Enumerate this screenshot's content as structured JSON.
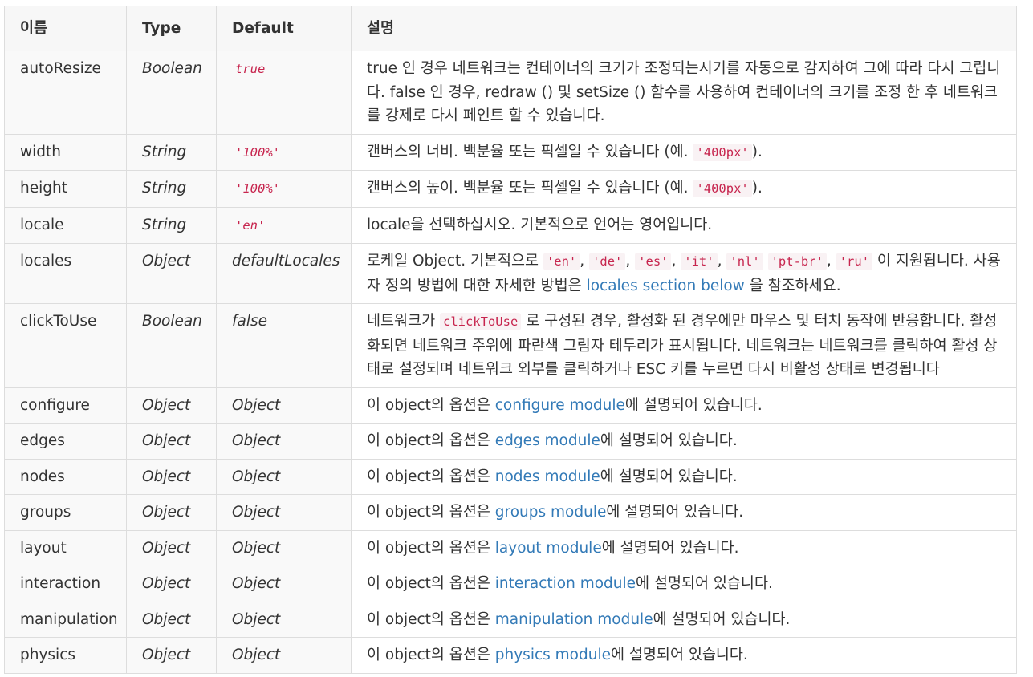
{
  "headers": {
    "name": "이름",
    "type": "Type",
    "default": "Default",
    "desc": "설명"
  },
  "colors": {
    "code_text": "#c7254e",
    "code_bg": "#f9f2f4",
    "link": "#337ab7",
    "border": "#dddddd"
  },
  "rows": {
    "autoResize": {
      "name": "autoResize",
      "type": "Boolean",
      "default": "true",
      "desc": "true 인 경우 네트워크는 컨테이너의 크기가 조정되는시기를 자동으로 감지하여 그에 따라 다시 그립니다. false 인 경우, redraw () 및 setSize () 함수를 사용하여 컨테이너의 크기를 조정 한 후 네트워크를 강제로 다시 페인트 할 수 있습니다."
    },
    "width": {
      "name": "width",
      "type": "String",
      "default": "'100%'",
      "desc_pre": "캔버스의 너비. 백분율 또는 픽셀일 수 있습니다 (예. ",
      "desc_code": "'400px'",
      "desc_post": ")."
    },
    "height": {
      "name": "height",
      "type": "String",
      "default": "'100%'",
      "desc_pre": "캔버스의 높이. 백분율 또는 픽셀일 수 있습니다 (예. ",
      "desc_code": "'400px'",
      "desc_post": ")."
    },
    "locale": {
      "name": "locale",
      "type": "String",
      "default": "'en'",
      "desc": "locale을 선택하십시오. 기본적으로 언어는 영어입니다."
    },
    "locales": {
      "name": "locales",
      "type": "Object",
      "default": "defaultLocales",
      "desc_pre": "로케일 Object. 기본적으로 ",
      "codes": [
        "'en'",
        "'de'",
        "'es'",
        "'it'",
        "'nl'",
        "'pt-br'",
        "'ru'"
      ],
      "sep": ",",
      "desc_mid": " 이 지원됩니다. 사용자 정의 방법에 대한 자세한 방법은 ",
      "link": "locales section below",
      "desc_post": " 을 참조하세요."
    },
    "clickToUse": {
      "name": "clickToUse",
      "type": "Boolean",
      "default": "false",
      "desc_pre": "네트워크가 ",
      "desc_code": "clickToUse",
      "desc_post": " 로 구성된 경우, 활성화 된 경우에만 마우스 및 터치 동작에 반응합니다. 활성화되면 네트워크 주위에 파란색 그림자 테두리가 표시됩니다. 네트워크는 네트워크를 클릭하여 활성 상태로 설정되며 네트워크 외부를 클릭하거나 ESC 키를 누르면 다시 비활성 상태로 변경됩니다"
    },
    "modules": [
      {
        "name": "configure",
        "type": "Object",
        "default": "Object",
        "pre": "이 object의 옵션은 ",
        "link": "configure module",
        "post": "에 설명되어 있습니다."
      },
      {
        "name": "edges",
        "type": "Object",
        "default": "Object",
        "pre": "이 object의 옵션은 ",
        "link": "edges module",
        "post": "에 설명되어 있습니다."
      },
      {
        "name": "nodes",
        "type": "Object",
        "default": "Object",
        "pre": "이 object의 옵션은 ",
        "link": "nodes module",
        "post": "에 설명되어 있습니다."
      },
      {
        "name": "groups",
        "type": "Object",
        "default": "Object",
        "pre": "이 object의 옵션은 ",
        "link": "groups module",
        "post": "에 설명되어 있습니다."
      },
      {
        "name": "layout",
        "type": "Object",
        "default": "Object",
        "pre": "이 object의 옵션은 ",
        "link": "layout module",
        "post": "에 설명되어 있습니다."
      },
      {
        "name": "interaction",
        "type": "Object",
        "default": "Object",
        "pre": "이 object의 옵션은 ",
        "link": "interaction module",
        "post": "에 설명되어 있습니다."
      },
      {
        "name": "manipulation",
        "type": "Object",
        "default": "Object",
        "pre": "이 object의 옵션은 ",
        "link": "manipulation module",
        "post": "에 설명되어 있습니다."
      },
      {
        "name": "physics",
        "type": "Object",
        "default": "Object",
        "pre": "이 object의 옵션은 ",
        "link": "physics module",
        "post": "에 설명되어 있습니다."
      }
    ]
  }
}
